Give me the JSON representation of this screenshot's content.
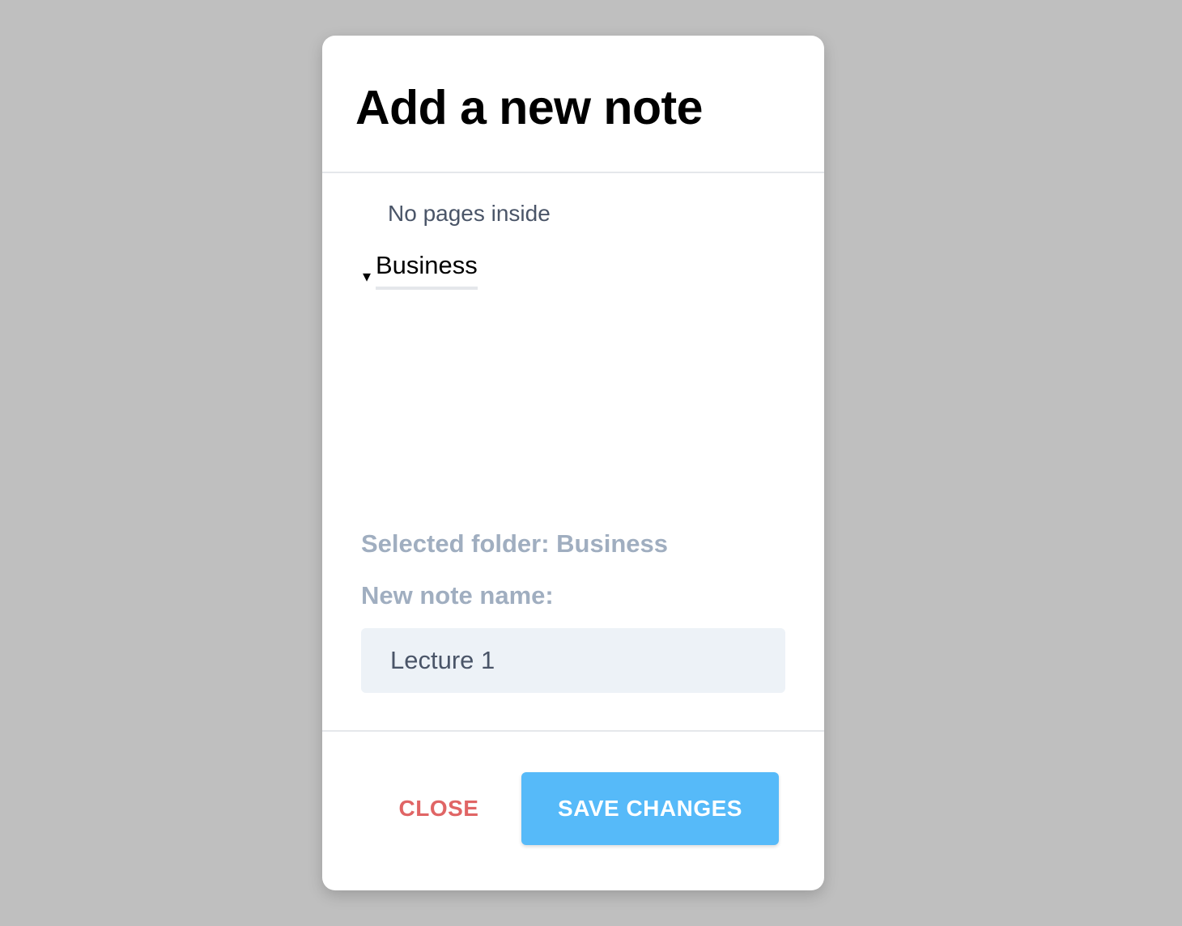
{
  "modal": {
    "title": "Add a new note"
  },
  "tree": {
    "caret": "▾",
    "folder_name": "Business",
    "empty_message": "No pages inside"
  },
  "form": {
    "selected_folder_label": "Selected folder: Business",
    "note_name_label": "New note name:",
    "note_name_value": "Lecture 1"
  },
  "footer": {
    "close_label": "CLOSE",
    "save_label": "SAVE CHANGES"
  },
  "colors": {
    "backdrop": "#bfbfbf",
    "close": "#e06565",
    "save": "#56baf9",
    "muted_label": "#a0aec0",
    "input_bg": "#edf2f7"
  }
}
